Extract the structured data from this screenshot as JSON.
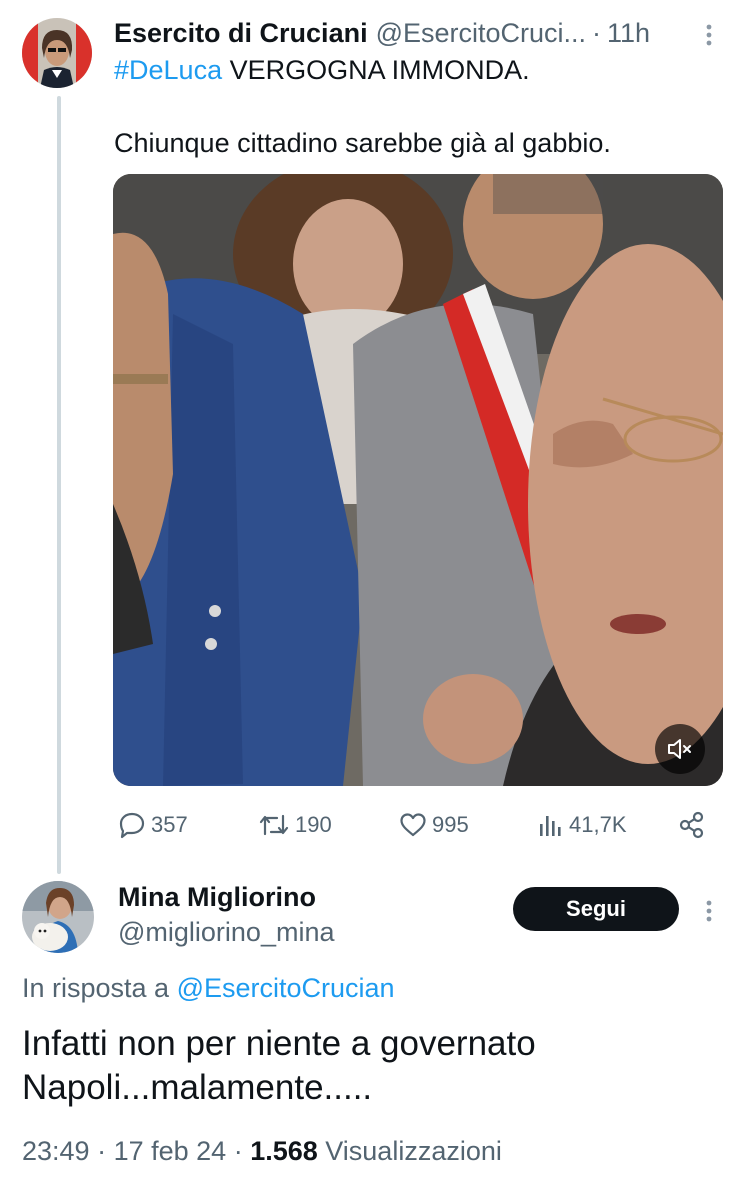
{
  "tweet": {
    "author_name": "Esercito di Cruciani",
    "author_handle": "@EsercitoCruci...",
    "separator": "·",
    "time": "11h",
    "hashtag": "#DeLuca",
    "text_line1": " VERGOGNA IMMONDA.",
    "text_line2": "Chiunque cittadino sarebbe già al gabbio.",
    "media": {
      "type": "video",
      "muted": true,
      "mute_icon": "speaker-muted-icon"
    },
    "actions": {
      "replies": "357",
      "retweets": "190",
      "likes": "995",
      "views": "41,7K"
    }
  },
  "reply": {
    "author_name": "Mina Migliorino",
    "author_handle": "@migliorino_mina",
    "follow_label": "Segui",
    "reply_prefix": "In risposta a ",
    "reply_mention": "@EsercitoCrucian",
    "text_line1": "Infatti non per niente a governato",
    "text_line2": "Napoli...malamente.....",
    "time": "23:49",
    "sep1": " · ",
    "date": "17 feb 24",
    "sep2": " · ",
    "views_count": "1.568",
    "views_label": " Visualizzazioni"
  },
  "colors": {
    "accent": "#1d9bf0",
    "text": "#0f1419",
    "secondary": "#536471",
    "thread_line": "#cfd9de",
    "button_bg": "#0f1419"
  }
}
